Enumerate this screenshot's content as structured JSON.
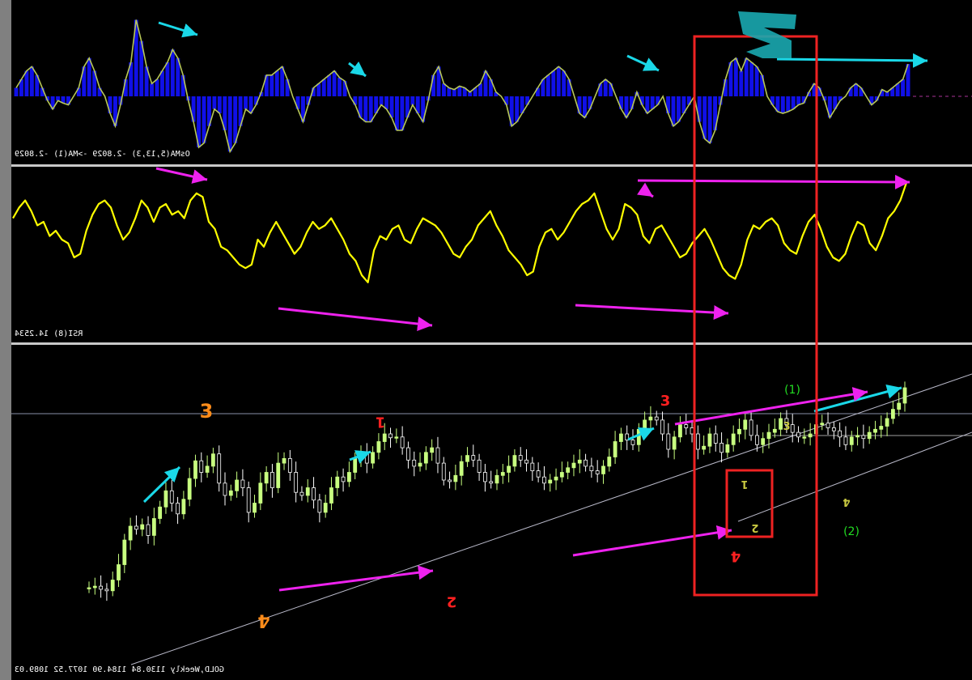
{
  "window": {
    "bg": "#000000",
    "left_strip": "#7f7f7f"
  },
  "osma_panel": {
    "label": "OsMA(5,13,3) -2.8029 ->MA(1) -2.8029",
    "colors": {
      "bar": "#1010e8",
      "line": "#b8c858"
    }
  },
  "rsi_panel": {
    "label": "RSI(8) 14.2534",
    "color": "#ffff00"
  },
  "price_panel": {
    "label": "GOLD,Weekly 1130.84 1184.90 1077.52 1089.03",
    "colors": {
      "candle_up": "#c8ff80",
      "candle_down": "#ffffff",
      "trendline": "#b8b8c8"
    },
    "wave_labels": [
      {
        "text": "3",
        "color": "#ff8c1a"
      },
      {
        "text": "4",
        "color": "#ff8c1a"
      },
      {
        "text": "1",
        "color": "#ff2020"
      },
      {
        "text": "2",
        "color": "#ff2020"
      },
      {
        "text": "3",
        "color": "#ff2020"
      },
      {
        "text": "4",
        "color": "#ff2020"
      },
      {
        "text": "(1)",
        "color": "#22dd22"
      },
      {
        "text": "(2)",
        "color": "#22dd22"
      },
      {
        "text": "1",
        "color": "#c8c840"
      },
      {
        "text": "2",
        "color": "#c8c840"
      },
      {
        "text": "3",
        "color": "#c8c840"
      },
      {
        "text": "4",
        "color": "#c8c840"
      }
    ]
  },
  "annotation_colors": {
    "cyan": "#1ad8e8",
    "magenta": "#ee22ee",
    "box": "#ee2222",
    "logo": "#1aa8b0"
  },
  "chart_data": [
    {
      "type": "bar",
      "title": "OsMA(5,13,3) -2.8029 ->MA(1) -2.8029",
      "series": [
        {
          "name": "OsMA",
          "values": [
            10,
            20,
            30,
            35,
            25,
            10,
            -5,
            -15,
            -5,
            -8,
            -10,
            0,
            10,
            35,
            45,
            30,
            10,
            0,
            -20,
            -35,
            -10,
            20,
            40,
            90,
            65,
            35,
            15,
            20,
            30,
            40,
            55,
            45,
            25,
            -5,
            -30,
            -60,
            -55,
            -35,
            -15,
            -20,
            -40,
            -65,
            -55,
            -35,
            -15,
            -20,
            -10,
            5,
            25,
            25,
            30,
            35,
            20,
            0,
            -15,
            -30,
            -10,
            10,
            15,
            20,
            25,
            30,
            22,
            18,
            0,
            -10,
            -25,
            -30,
            -30,
            -20,
            -10,
            -15,
            -25,
            -40,
            -40,
            -25,
            -10,
            -20,
            -30,
            -5,
            25,
            35,
            15,
            10,
            8,
            12,
            10,
            5,
            10,
            15,
            30,
            20,
            5,
            0,
            -10,
            -35,
            -30,
            -20,
            -10,
            0,
            10,
            20,
            25,
            30,
            35,
            30,
            20,
            0,
            -20,
            -25,
            -15,
            0,
            15,
            20,
            15,
            0,
            -15,
            -25,
            -15,
            5,
            -10,
            -20,
            -15,
            -10,
            0,
            -20,
            -35,
            -30,
            -20,
            -10,
            0,
            -30,
            -50,
            -55,
            -40,
            -10,
            20,
            40,
            45,
            30,
            45,
            40,
            35,
            25,
            0,
            -10,
            -18,
            -20,
            -18,
            -15,
            -10,
            -8,
            5,
            15,
            10,
            -5,
            -25,
            -15,
            -5,
            0,
            10,
            15,
            10,
            0,
            -10,
            -5,
            8,
            5,
            10,
            15,
            20,
            38
          ]
        }
      ]
    },
    {
      "type": "line",
      "title": "RSI(8) 14.2534",
      "series": [
        {
          "name": "RSI(8)",
          "values": [
            62,
            68,
            72,
            66,
            58,
            60,
            52,
            55,
            50,
            48,
            40,
            42,
            55,
            64,
            70,
            72,
            68,
            58,
            50,
            54,
            62,
            72,
            68,
            60,
            68,
            70,
            64,
            66,
            62,
            72,
            76,
            74,
            60,
            56,
            46,
            44,
            40,
            36,
            34,
            36,
            50,
            46,
            54,
            60,
            54,
            48,
            42,
            46,
            54,
            60,
            56,
            58,
            62,
            56,
            50,
            42,
            38,
            30,
            26,
            44,
            52,
            50,
            56,
            58,
            50,
            48,
            56,
            62,
            60,
            58,
            54,
            48,
            42,
            40,
            46,
            50,
            58,
            62,
            66,
            58,
            52,
            44,
            40,
            36,
            30,
            32,
            46,
            54,
            56,
            50,
            54,
            60,
            66,
            70,
            72,
            76,
            66,
            56,
            50,
            56,
            70,
            68,
            64,
            52,
            48,
            56,
            58,
            52,
            46,
            40,
            42,
            48,
            52,
            56,
            50,
            42,
            34,
            30,
            28,
            36,
            50,
            58,
            56,
            60,
            62,
            58,
            48,
            44,
            42,
            52,
            60,
            64,
            56,
            46,
            40,
            38,
            42,
            52,
            60,
            58,
            48,
            44,
            52,
            62,
            66,
            72,
            82
          ]
        }
      ]
    },
    {
      "type": "candlestick",
      "title": "GOLD,Weekly 1130.84 1184.90 1077.52 1089.03",
      "series": [
        {
          "name": "GOLD,Weekly",
          "values": [
            100,
            102,
            98,
            96,
            110,
            130,
            162,
            180,
            176,
            182,
            168,
            190,
            205,
            226,
            210,
            196,
            215,
            242,
            265,
            250,
            258,
            274,
            236,
            220,
            226,
            240,
            230,
            198,
            210,
            236,
            250,
            230,
            262,
            268,
            250,
            224,
            220,
            230,
            214,
            198,
            210,
            230,
            244,
            238,
            250,
            268,
            274,
            262,
            276,
            290,
            300,
            295,
            296,
            282,
            266,
            258,
            262,
            276,
            282,
            262,
            240,
            238,
            246,
            264,
            272,
            266,
            250,
            238,
            236,
            246,
            250,
            258,
            272,
            266,
            262,
            252,
            244,
            236,
            240,
            244,
            250,
            256,
            262,
            266,
            258,
            252,
            248,
            258,
            270,
            290,
            300,
            292,
            286,
            306,
            318,
            322,
            318,
            300,
            280,
            296,
            312,
            308,
            300,
            280,
            284,
            300,
            288,
            276,
            286,
            300,
            306,
            318,
            298,
            286,
            294,
            302,
            306,
            320,
            312,
            302,
            296,
            296,
            300,
            312,
            314,
            308,
            304,
            296,
            286,
            296,
            298,
            294,
            302,
            306,
            310,
            320,
            332,
            340,
            360
          ]
        }
      ]
    }
  ]
}
